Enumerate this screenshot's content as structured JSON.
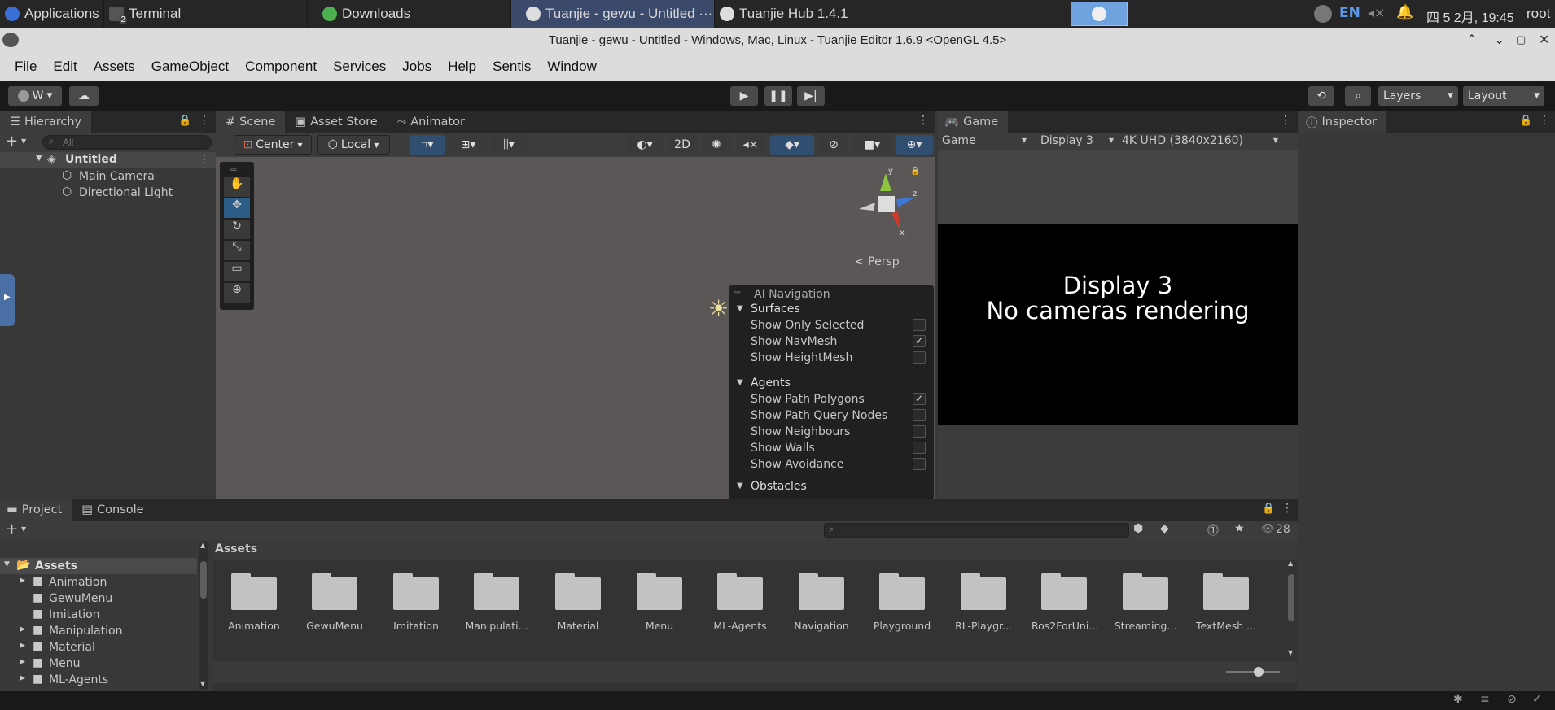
{
  "taskbar": {
    "applications": "Applications",
    "terminal": "Terminal",
    "terminal_badge": "2",
    "downloads": "Downloads",
    "tuanjie_window": "Tuanjie - gewu - Untitled ···",
    "hub": "Tuanjie Hub 1.4.1",
    "lang": "EN",
    "clock": "四 5 2月, 19:45",
    "user": "root"
  },
  "window": {
    "title": "Tuanjie - gewu - Untitled - Windows, Mac, Linux - Tuanjie Editor 1.6.9 <OpenGL 4.5>"
  },
  "menu": [
    "File",
    "Edit",
    "Assets",
    "GameObject",
    "Component",
    "Services",
    "Jobs",
    "Help",
    "Sentis",
    "Window"
  ],
  "toolbar": {
    "account": "W",
    "layers": "Layers",
    "layout": "Layout"
  },
  "hierarchy": {
    "tab": "Hierarchy",
    "search_placeholder": "All",
    "scene": "Untitled",
    "items": [
      "Main Camera",
      "Directional Light"
    ]
  },
  "scene": {
    "tabs": [
      "Scene",
      "Asset Store",
      "Animator"
    ],
    "pivot": "Center",
    "space": "Local",
    "mode2d": "2D",
    "persp": "< Persp"
  },
  "ai_nav": {
    "title": "AI Navigation",
    "sections": [
      {
        "name": "Surfaces",
        "options": [
          {
            "label": "Show Only Selected",
            "checked": false
          },
          {
            "label": "Show NavMesh",
            "checked": true
          },
          {
            "label": "Show HeightMesh",
            "checked": false
          }
        ]
      },
      {
        "name": "Agents",
        "options": [
          {
            "label": "Show Path Polygons",
            "checked": true
          },
          {
            "label": "Show Path Query Nodes",
            "checked": false
          },
          {
            "label": "Show Neighbours",
            "checked": false
          },
          {
            "label": "Show Walls",
            "checked": false
          },
          {
            "label": "Show Avoidance",
            "checked": false
          }
        ]
      },
      {
        "name": "Obstacles",
        "options": []
      }
    ]
  },
  "game": {
    "tab": "Game",
    "mode": "Game",
    "display": "Display 3",
    "resolution": "4K UHD (3840x2160)",
    "line1": "Display 3",
    "line2": "No cameras rendering"
  },
  "inspector": {
    "tab": "Inspector"
  },
  "project": {
    "tabs": [
      "Project",
      "Console"
    ],
    "count": "28",
    "breadcrumb": "Assets",
    "tree_root": "Assets",
    "tree": [
      "Animation",
      "GewuMenu",
      "Imitation",
      "Manipulation",
      "Material",
      "Menu",
      "ML-Agents"
    ],
    "folders": [
      "Animation",
      "GewuMenu",
      "Imitation",
      "Manipulati...",
      "Material",
      "Menu",
      "ML-Agents",
      "Navigation",
      "Playground",
      "RL-Playgr...",
      "Ros2ForUni...",
      "Streaming...",
      "TextMesh ..."
    ]
  }
}
